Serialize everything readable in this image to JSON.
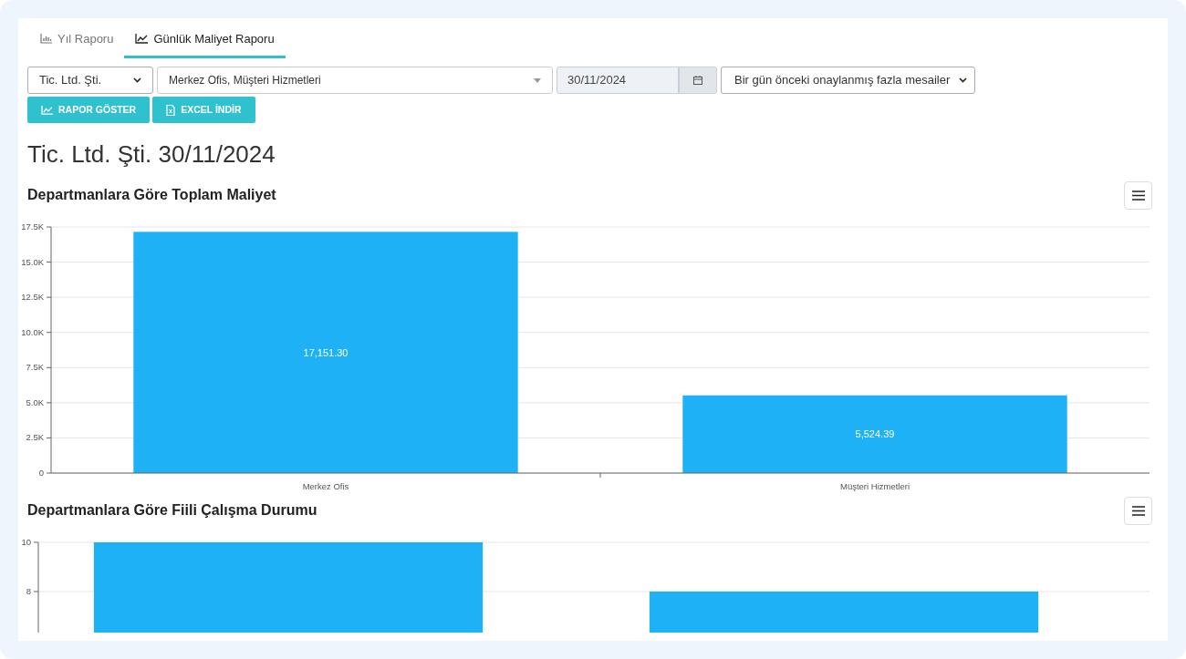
{
  "tabs": [
    {
      "label": "Yıl Raporu",
      "kind": "bar",
      "selected": false
    },
    {
      "label": "Günlük Maliyet Raporu",
      "kind": "line",
      "selected": true
    }
  ],
  "filters": {
    "company": "Tic. Ltd. Şti.",
    "departments": "Merkez Ofis, Müşteri Hizmetleri",
    "date": "30/11/2024",
    "overtime": "Bir gün önceki onaylanmış fazla mesailer"
  },
  "buttons": [
    {
      "label": "RAPOR GÖSTER",
      "kind": "chart"
    },
    {
      "label": "EXCEL İNDİR",
      "kind": "excel"
    }
  ],
  "report_title": "Tic. Ltd. Şti. 30/11/2024",
  "charts": [
    {
      "title": "Departmanlara Göre Toplam Maliyet",
      "chart_data": {
        "type": "bar",
        "categories": [
          "Merkez Ofis",
          "Müşteri Hizmetleri"
        ],
        "values": [
          17151.3,
          5524.39
        ],
        "grid": true,
        "ylim": [
          0,
          17500
        ],
        "yticks": [
          {
            "value": 0,
            "label": "0"
          },
          {
            "value": 2500,
            "label": "2.5K"
          },
          {
            "value": 5000,
            "label": "5.0K"
          },
          {
            "value": 7500,
            "label": "7.5K"
          },
          {
            "value": 10000,
            "label": "10.0K"
          },
          {
            "value": 12500,
            "label": "12.5K"
          },
          {
            "value": 15000,
            "label": "15.0K"
          },
          {
            "value": 17500,
            "label": "17.5K"
          }
        ],
        "value_labels": [
          "17,151.30",
          "5,524.39"
        ]
      }
    },
    {
      "title": "Departmanlara Göre Fiili Çalışma Durumu",
      "chart_data": {
        "type": "bar",
        "values": [
          10,
          8
        ],
        "grid": true,
        "ylim": [
          6.333,
          10
        ],
        "yticks": [
          8,
          10
        ]
      }
    }
  ]
}
